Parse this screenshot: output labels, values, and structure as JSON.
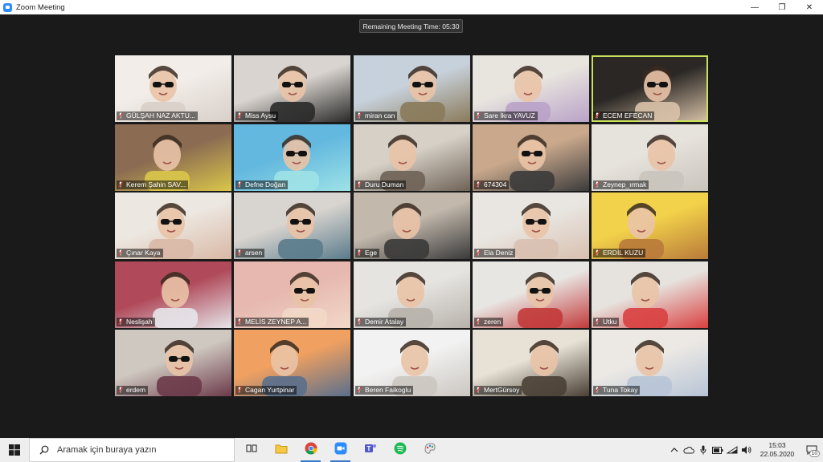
{
  "window": {
    "title": "Zoom Meeting",
    "minimize_glyph": "—",
    "maximize_glyph": "❐",
    "close_glyph": "✕"
  },
  "meeting": {
    "timer_text": "Remaining Meeting Time: 05:30",
    "active_speaker_color": "#c8e05a",
    "muted_icon": "mic-muted-icon",
    "participants": [
      {
        "name": "GÜLŞAH NAZ AKTU...",
        "bg": [
          "#f2ede9",
          "#d8cfc8"
        ],
        "glasses": true
      },
      {
        "name": "Miss Aysu",
        "bg": [
          "#d9d4cf",
          "#2a2a2a"
        ],
        "glasses": true
      },
      {
        "name": "miran can",
        "bg": [
          "#c7d1db",
          "#8a7a5a"
        ],
        "glasses": true
      },
      {
        "name": "Sare İkra YAVUZ",
        "bg": [
          "#e8e4de",
          "#b9a2c8"
        ],
        "glasses": false
      },
      {
        "name": "ECEM EFECAN",
        "bg": [
          "#2a2724",
          "#d9c2a8"
        ],
        "glasses": true,
        "active": true
      },
      {
        "name": "Kerem Şahin SAV...",
        "bg": [
          "#8b6b52",
          "#d9c64a"
        ],
        "glasses": false
      },
      {
        "name": "Defne Doğan",
        "bg": [
          "#63b8df",
          "#9de2e6"
        ],
        "glasses": true
      },
      {
        "name": "Duru Duman",
        "bg": [
          "#d6d0c6",
          "#6f6357"
        ],
        "glasses": false
      },
      {
        "name": "674304",
        "bg": [
          "#c9a88c",
          "#3b3b3b"
        ],
        "glasses": true
      },
      {
        "name": "Zeynep_ırmak",
        "bg": [
          "#e6e2dc",
          "#c9c4bc"
        ],
        "glasses": false
      },
      {
        "name": "Çınar Kaya",
        "bg": [
          "#ece7e0",
          "#d9b8a6"
        ],
        "glasses": true
      },
      {
        "name": "arsen",
        "bg": [
          "#d8d4cf",
          "#5b7c8c"
        ],
        "glasses": true
      },
      {
        "name": "Ege",
        "bg": [
          "#c2b8ac",
          "#3a3a3a"
        ],
        "glasses": false
      },
      {
        "name": "Ela Deniz",
        "bg": [
          "#e9e6e1",
          "#d8c0b0"
        ],
        "glasses": true
      },
      {
        "name": "ERDİL KUZU",
        "bg": [
          "#f2d24a",
          "#b97a3a"
        ],
        "glasses": false
      },
      {
        "name": "Neslişah",
        "bg": [
          "#b04a5a",
          "#e6e6ea"
        ],
        "glasses": false
      },
      {
        "name": "MELİS ZEYNEP A...",
        "bg": [
          "#e6b8b0",
          "#f2d8c8"
        ],
        "glasses": true
      },
      {
        "name": "Demir Atalay",
        "bg": [
          "#e6e4e1",
          "#b7b2ab"
        ],
        "glasses": false
      },
      {
        "name": "zeren",
        "bg": [
          "#e8e6e3",
          "#c23a3a"
        ],
        "glasses": true
      },
      {
        "name": "Utku",
        "bg": [
          "#e6e3de",
          "#d94040"
        ],
        "glasses": false
      },
      {
        "name": "erdem",
        "bg": [
          "#cfc8c0",
          "#6b3a4a"
        ],
        "glasses": true
      },
      {
        "name": "Cagan Yurtpinar",
        "bg": [
          "#f0a060",
          "#5a6f8c"
        ],
        "glasses": false
      },
      {
        "name": "Beren Faikoglu",
        "bg": [
          "#f2f2f2",
          "#cbc6c0"
        ],
        "glasses": false
      },
      {
        "name": "MertGürsoy",
        "bg": [
          "#e8e2d6",
          "#4a4035"
        ],
        "glasses": false
      },
      {
        "name": "Tuna Tokay",
        "bg": [
          "#ece9e4",
          "#b7c4d6"
        ],
        "glasses": false
      }
    ]
  },
  "taskbar": {
    "start_icon": "windows-logo-icon",
    "search_placeholder": "Aramak için buraya yazın",
    "apps": [
      {
        "icon": "task-view-icon",
        "running": false
      },
      {
        "icon": "file-explorer-icon",
        "running": false
      },
      {
        "icon": "chrome-icon",
        "running": true
      },
      {
        "icon": "zoom-icon",
        "running": true
      },
      {
        "icon": "teams-icon",
        "running": false
      },
      {
        "icon": "spotify-icon",
        "running": false
      },
      {
        "icon": "paint-icon",
        "running": false
      }
    ],
    "tray_icons": [
      "chevron-up-icon",
      "cloud-icon",
      "microphone-icon",
      "battery-icon",
      "network-icon",
      "volume-icon"
    ],
    "time": "15:03",
    "date": "22.05.2020",
    "notification_count": "10"
  }
}
